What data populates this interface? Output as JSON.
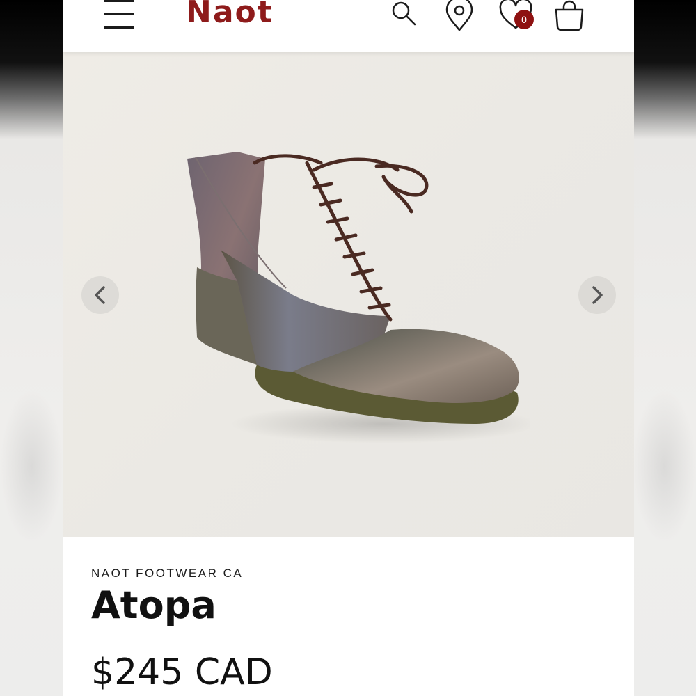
{
  "header": {
    "logo_text": "Naot",
    "wishlist_count": "0",
    "icons": [
      "menu-icon",
      "search-icon",
      "location-pin-icon",
      "heart-icon",
      "shopping-bag-icon"
    ]
  },
  "gallery": {
    "prev_icon": "chevron-left-icon",
    "next_icon": "chevron-right-icon"
  },
  "product": {
    "vendor": "NAOT FOOTWEAR CA",
    "title": "Atopa",
    "price": "$245 CAD"
  },
  "colors": {
    "brand": "#8e1b1b",
    "badge": "#8e1111",
    "text": "#111111"
  }
}
